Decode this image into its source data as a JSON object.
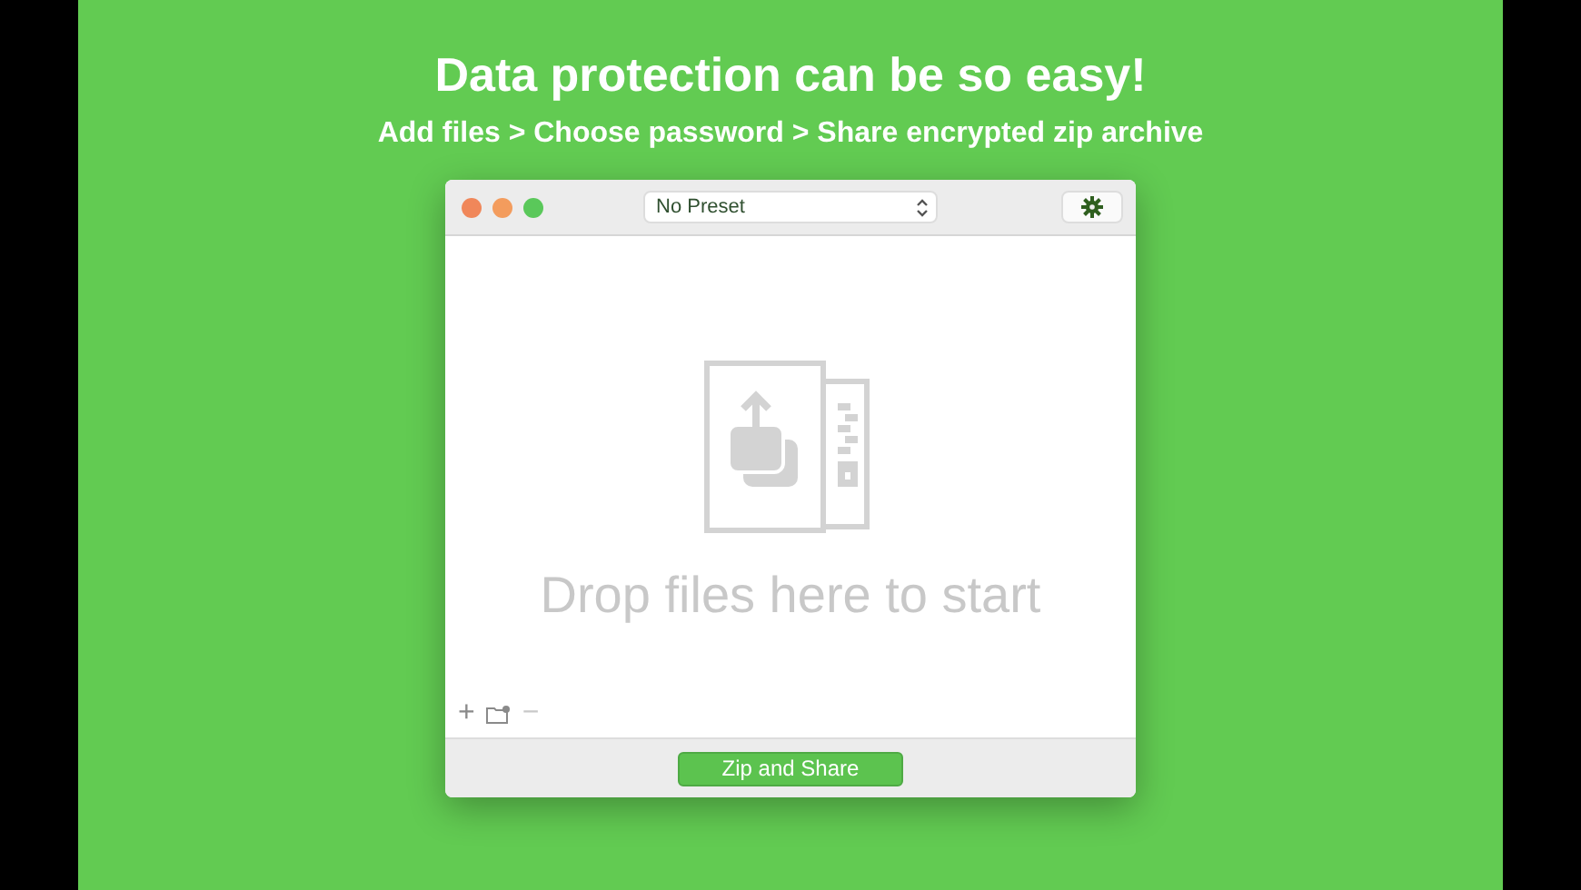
{
  "headline": "Data protection can be so easy!",
  "subtitle": "Add files > Choose password > Share encrypted zip archive",
  "window": {
    "preset": {
      "value": "No Preset"
    },
    "drop_hint": "Drop files here to start",
    "toolbar": [
      {
        "kind": "text",
        "label": "+",
        "disabled": false
      },
      {
        "kind": "folder",
        "disabled": false
      },
      {
        "kind": "text",
        "label": "−",
        "disabled": true
      }
    ],
    "primary_button": "Zip and Share"
  }
}
